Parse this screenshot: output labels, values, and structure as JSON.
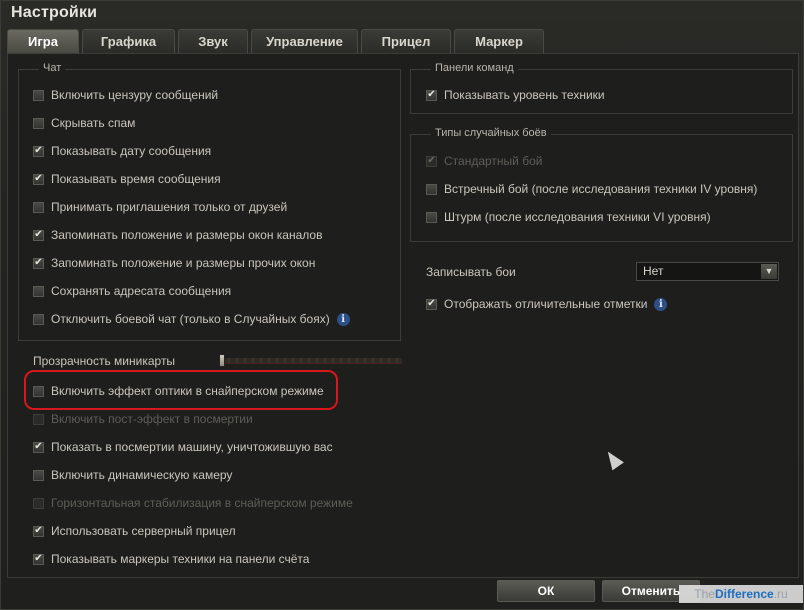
{
  "window": {
    "title": "Настройки"
  },
  "tabs": [
    {
      "label": "Игра"
    },
    {
      "label": "Графика"
    },
    {
      "label": "Звук"
    },
    {
      "label": "Управление"
    },
    {
      "label": "Прицел"
    },
    {
      "label": "Маркер"
    }
  ],
  "chat": {
    "title": "Чат",
    "items": [
      {
        "label": "Включить цензуру сообщений",
        "checked": false
      },
      {
        "label": "Скрывать спам",
        "checked": false
      },
      {
        "label": "Показывать дату сообщения",
        "checked": true
      },
      {
        "label": "Показывать время сообщения",
        "checked": true
      },
      {
        "label": "Принимать приглашения только от друзей",
        "checked": false
      },
      {
        "label": "Запоминать положение и размеры окон каналов",
        "checked": true
      },
      {
        "label": "Запоминать положение и размеры прочих окон",
        "checked": true
      },
      {
        "label": "Сохранять адресата сообщения",
        "checked": false
      },
      {
        "label": "Отключить боевой чат (только в Случайных боях)",
        "checked": false
      }
    ]
  },
  "command_panels": {
    "title": "Панели команд",
    "items": [
      {
        "label": "Показывать уровень техники",
        "checked": true
      }
    ]
  },
  "battle_types": {
    "title": "Типы случайных боёв",
    "items": [
      {
        "label": "Стандартный бой",
        "checked": true,
        "disabled": true
      },
      {
        "label": "Встречный бой (после исследования техники IV уровня)",
        "checked": false
      },
      {
        "label": "Штурм (после исследования техники VI уровня)",
        "checked": false
      }
    ]
  },
  "record": {
    "label": "Записывать бои",
    "value": "Нет"
  },
  "marks": {
    "label": "Отображать отличительные отметки",
    "checked": true
  },
  "minimap": {
    "label": "Прозрачность миникарты"
  },
  "lower_items": [
    {
      "label": "Включить эффект оптики в снайперском режиме",
      "checked": false,
      "disabled": false
    },
    {
      "label": "Включить пост-эффект в посмертии",
      "checked": false,
      "disabled": true
    },
    {
      "label": "Показать в посмертии машину, уничтожившую вас",
      "checked": true,
      "disabled": false
    },
    {
      "label": "Включить динамическую камеру",
      "checked": false,
      "disabled": false
    },
    {
      "label": "Горизонтальная стабилизация в снайперском режиме",
      "checked": false,
      "disabled": true
    },
    {
      "label": "Использовать серверный прицел",
      "checked": true,
      "disabled": false
    },
    {
      "label": "Показывать маркеры техники на панели счёта",
      "checked": true,
      "disabled": false
    }
  ],
  "buttons": {
    "ok": "ОК",
    "cancel": "Отменить"
  },
  "watermark": {
    "the": "The",
    "difference": "Difference",
    "ru": ".ru"
  },
  "icons": {
    "check": "✔",
    "info": "i",
    "dropdown": "▼"
  }
}
